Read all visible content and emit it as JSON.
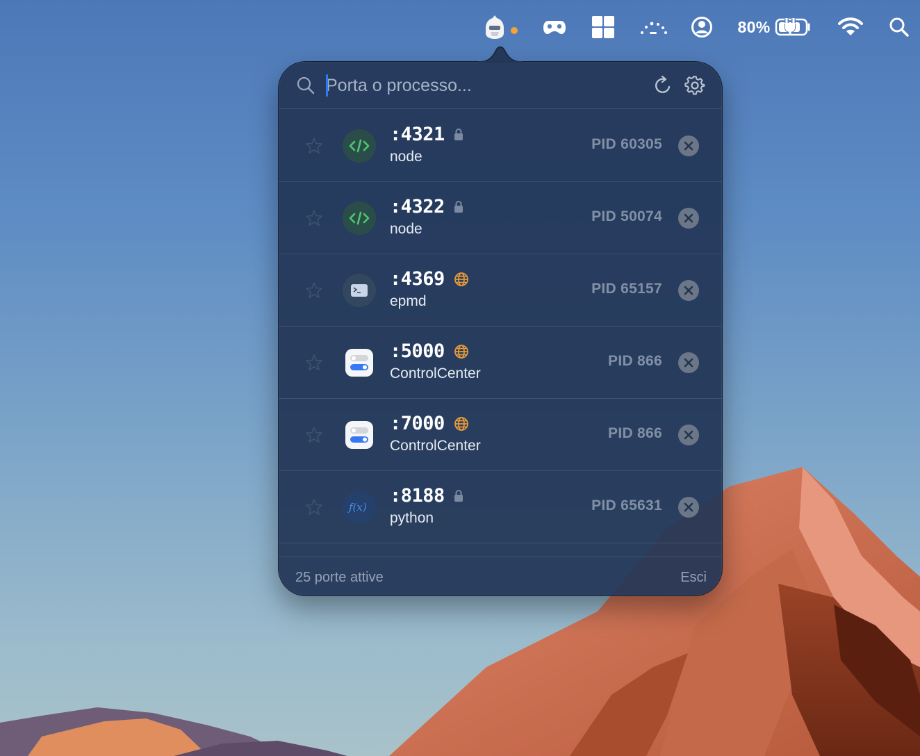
{
  "menubar": {
    "battery_percent": "80%",
    "icons": [
      "portkiller-app-icon",
      "gamepad-icon",
      "windows-grid-icon",
      "dots-arc-icon",
      "user-circle-icon",
      "battery-charging-icon",
      "wifi-icon",
      "spotlight-search-icon"
    ],
    "status_dot_color": "#f2a33a"
  },
  "popover": {
    "search": {
      "placeholder": "Porta o processo...",
      "value": ""
    },
    "rows": [
      {
        "port": ":4321",
        "process": "node",
        "pid": "PID 60305",
        "badge": "lock-icon",
        "app_icon": "code-icon"
      },
      {
        "port": ":4322",
        "process": "node",
        "pid": "PID 50074",
        "badge": "lock-icon",
        "app_icon": "code-icon"
      },
      {
        "port": ":4369",
        "process": "epmd",
        "pid": "PID 65157",
        "badge": "globe-icon",
        "app_icon": "terminal-icon"
      },
      {
        "port": ":5000",
        "process": "ControlCenter",
        "pid": "PID 866",
        "badge": "globe-icon",
        "app_icon": "control-center-icon"
      },
      {
        "port": ":7000",
        "process": "ControlCenter",
        "pid": "PID 866",
        "badge": "globe-icon",
        "app_icon": "control-center-icon"
      },
      {
        "port": ":8188",
        "process": "python",
        "pid": "PID 65631",
        "badge": "lock-icon",
        "app_icon": "function-icon"
      }
    ],
    "footer": {
      "count_label": "25 porte attive",
      "quit_label": "Esci"
    }
  },
  "colors": {
    "accent": "#2f7bf6",
    "code_green": "#4cc86a",
    "globe_orange": "#e59a3a",
    "pid_gray": "#8190a6"
  }
}
